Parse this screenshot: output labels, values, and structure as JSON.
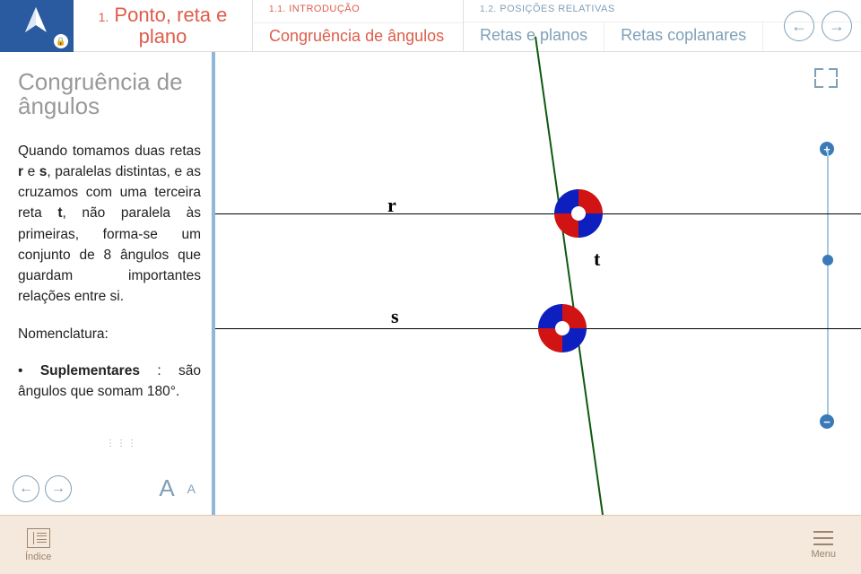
{
  "chapter": {
    "number": "1.",
    "title": "Ponto, reta e plano"
  },
  "sections": [
    {
      "number": "1.1.",
      "label": "INTRODUÇÃO",
      "active": true,
      "sub": "Congruência de ângulos"
    },
    {
      "number": "1.2.",
      "label": "POSIÇÕES RELATIVAS",
      "active": false,
      "subs": [
        "Retas e planos",
        "Retas coplanares"
      ]
    }
  ],
  "article": {
    "title": "Congruência de ângulos",
    "p1_a": "Quando tomamos duas retas ",
    "p1_r": "r",
    "p1_b": " e ",
    "p1_s": "s",
    "p1_c": ", paralelas distintas, e as cruzamos com uma terceira reta ",
    "p1_t": "t",
    "p1_d": ", não paralela às primeiras, forma-se um conjunto de 8 ângulos que guardam importantes relações entre si.",
    "p2": "Nomenclatura:",
    "p3_a": "• ",
    "p3_b": "Suplementares",
    "p3_c": " : são ângulos que somam 180°."
  },
  "diagram": {
    "label_r": "r",
    "label_s": "s",
    "label_t": "t"
  },
  "controls": {
    "font_large": "A",
    "font_small": "A",
    "zoom_plus": "+",
    "zoom_minus": "−"
  },
  "bottom": {
    "index": "Índice",
    "menu": "Menu"
  }
}
